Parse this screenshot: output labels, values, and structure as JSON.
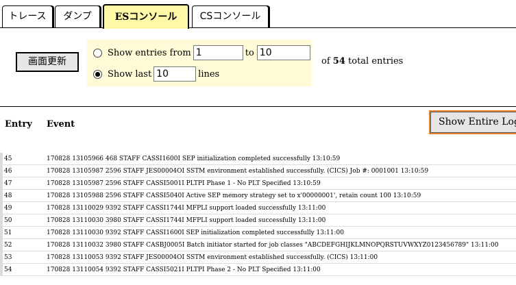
{
  "tabs": [
    {
      "label": "トレース",
      "active": false
    },
    {
      "label": "ダンプ",
      "active": false
    },
    {
      "label": "ESコンソール",
      "active": true
    },
    {
      "label": "CSコンソール",
      "active": false
    }
  ],
  "controls": {
    "refresh_label": "画面更新",
    "show_entries_from_label": "Show entries from",
    "from_value": "1",
    "to_label": "to",
    "to_value": "10",
    "show_last_label": "Show last",
    "last_value": "10",
    "lines_label": "lines",
    "selected_option": "show_last",
    "total_prefix": "of",
    "total_count": "54",
    "total_suffix": "total entries"
  },
  "table": {
    "col_entry": "Entry",
    "col_event": "Event",
    "show_entire_log_label": "Show Entire Log",
    "rows": [
      {
        "entry": "45",
        "event": "170828 13105966 468 STAFF CASSI1600I SEP initialization completed successfully 13:10:59"
      },
      {
        "entry": "46",
        "event": "170828 13105987 2596 STAFF JES00004OI SSTM environment established successfully. (CICS) Job #: 0001001 13:10:59"
      },
      {
        "entry": "47",
        "event": "170828 13105987 2596 STAFF CASSI5001I PLTPI Phase 1 - No PLT Specified 13:10:59"
      },
      {
        "entry": "48",
        "event": "170828 13105988 2596 STAFF CASSI5040I Active SEP memory strategy set to x'00000001', retain count 100 13:10:59"
      },
      {
        "entry": "49",
        "event": "170828 13110029 9392 STAFF CASSI1744I MFPLI support loaded successfully 13:11:00"
      },
      {
        "entry": "50",
        "event": "170828 13110030 3980 STAFF CASSI1744I MFPLI support loaded successfully 13:11:00"
      },
      {
        "entry": "51",
        "event": "170828 13110030 9392 STAFF CASSI1600I SEP initialization completed successfully 13:11:00"
      },
      {
        "entry": "52",
        "event": "170828 13110032 3980 STAFF CASBJ0005I Batch initiator started for job classes \"ABCDEFGHIJKLMNOPQRSTUVWXYZ0123456789\" 13:11:00"
      },
      {
        "entry": "53",
        "event": "170828 13110053 9392 STAFF JES00004OI SSTM environment established successfully. (CICS) 13:11:00"
      },
      {
        "entry": "54",
        "event": "170828 13110054 9392 STAFF CASSI5021I PLTPI Phase 2 - No PLT Specified 13:11:00"
      }
    ]
  },
  "colors": {
    "active_tab": "#fff8a6",
    "options_bg": "#fffbd6",
    "log_button_border": "#e8822c"
  }
}
